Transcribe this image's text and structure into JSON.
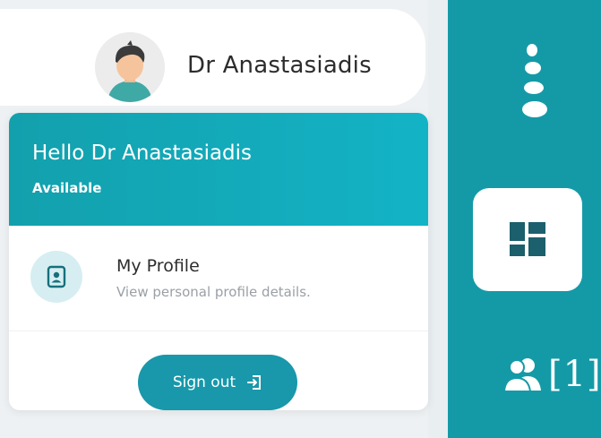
{
  "user": {
    "display_name": "Dr Anastasiadis",
    "avatar_icon": "user-avatar-icon"
  },
  "dropdown": {
    "greeting": "Hello Dr Anastasiadis",
    "status": "Available",
    "items": [
      {
        "title": "My Profile",
        "subtitle": "View personal profile details.",
        "icon": "profile-card-icon"
      }
    ],
    "signout_label": "Sign out",
    "signout_icon": "sign-out-icon"
  },
  "sidebar": {
    "menu_icon": "vertical-dots-icon",
    "dashboard_icon": "dashboard-grid-icon",
    "group_icon": "users-group-icon",
    "group_count": "[1]"
  },
  "colors": {
    "accent": "#149aa7",
    "header_gradient_start": "#13a0ad",
    "header_gradient_end": "#13b3c6",
    "button": "#1898aa"
  }
}
